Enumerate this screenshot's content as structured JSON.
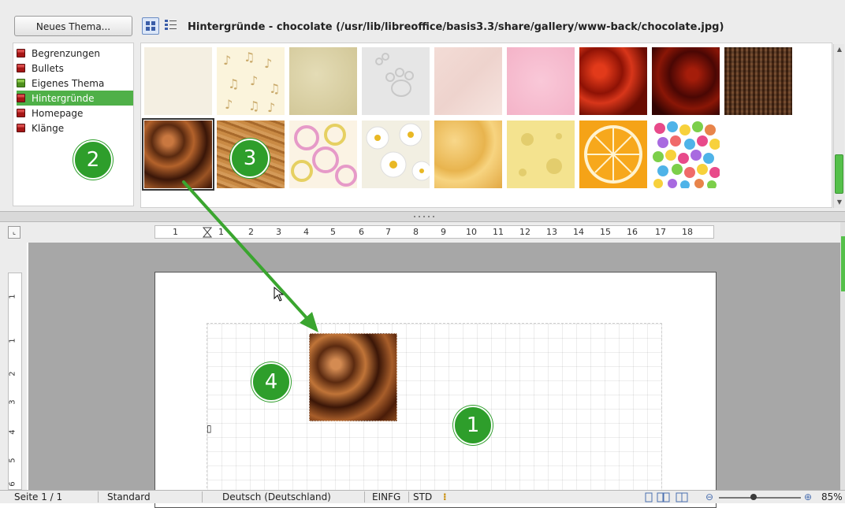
{
  "gallery": {
    "new_theme_button": "Neues Thema...",
    "path_title": "Hintergründe - chocolate (/usr/lib/libreoffice/basis3.3/share/gallery/www-back/chocolate.jpg)",
    "themes": [
      {
        "label": "Begrenzungen"
      },
      {
        "label": "Bullets"
      },
      {
        "label": "Eigenes Thema"
      },
      {
        "label": "Hintergründe",
        "active": true
      },
      {
        "label": "Homepage"
      },
      {
        "label": "Klänge"
      }
    ],
    "thumbnails": [
      {
        "name": "cream-paper"
      },
      {
        "name": "music-notes"
      },
      {
        "name": "beige-sand"
      },
      {
        "name": "paw-prints"
      },
      {
        "name": "pink-marble"
      },
      {
        "name": "pink-texture"
      },
      {
        "name": "red-roses"
      },
      {
        "name": "dark-red-flowers"
      },
      {
        "name": "brown-weave"
      },
      {
        "name": "chocolate",
        "selected": true
      },
      {
        "name": "wood"
      },
      {
        "name": "pink-rings"
      },
      {
        "name": "daisies"
      },
      {
        "name": "yellow-flowers"
      },
      {
        "name": "cheese"
      },
      {
        "name": "orange-slice"
      },
      {
        "name": "candy-dots"
      }
    ]
  },
  "ruler": {
    "h_ticks": [
      "1",
      "1",
      "2",
      "3",
      "4",
      "5",
      "6",
      "7",
      "8",
      "9",
      "10",
      "11",
      "12",
      "13",
      "14",
      "15",
      "16",
      "17",
      "18"
    ],
    "v_ticks": [
      "1",
      "1",
      "2",
      "3",
      "4",
      "5",
      "6"
    ]
  },
  "callouts": [
    "1",
    "2",
    "3",
    "4"
  ],
  "statusbar": {
    "page": "Seite 1 / 1",
    "style": "Standard",
    "language": "Deutsch (Deutschland)",
    "insert_mode": "EINFG",
    "selection_mode": "STD",
    "zoom": "85%"
  },
  "colors": {
    "accent_green": "#2e9e2b",
    "selection_green": "#4fb048",
    "arrow_green": "#3aa52f"
  }
}
